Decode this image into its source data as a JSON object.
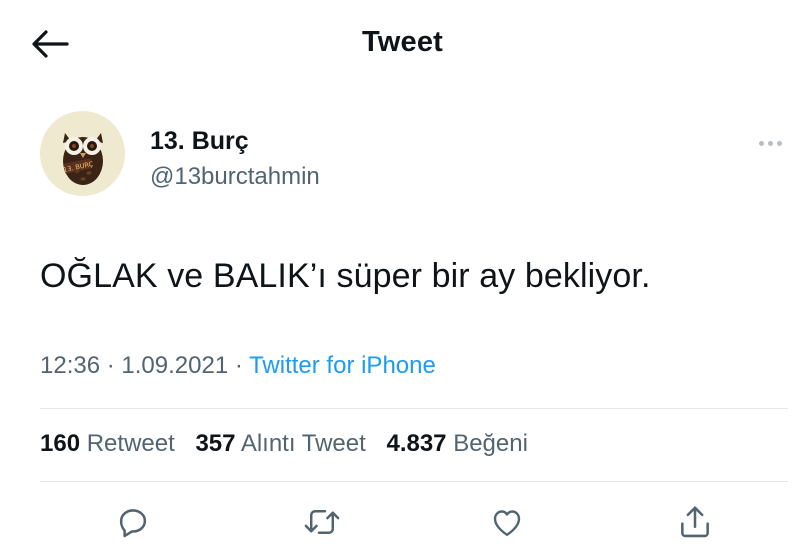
{
  "header": {
    "title": "Tweet",
    "back_icon": "arrow-left-icon"
  },
  "author": {
    "display_name": "13. Burç",
    "handle": "@13burctahmin",
    "avatar_text": "13. BURÇ"
  },
  "more_icon": "more-horizontal-icon",
  "tweet": {
    "text": "OĞLAK ve BALIK’ı süper bir ay bekliyor.",
    "time": "12:36",
    "separator": " · ",
    "date": "1.09.2021",
    "source": "Twitter for iPhone"
  },
  "stats": {
    "retweets_count": "160",
    "retweets_label": "Retweet",
    "quotes_count": "357",
    "quotes_label": "Alıntı Tweet",
    "likes_count": "4.837",
    "likes_label": "Beğeni"
  },
  "actions": [
    "reply-icon",
    "retweet-icon",
    "like-icon",
    "share-icon"
  ],
  "colors": {
    "link": "#1d9bf0",
    "secondary": "#536471",
    "divider": "#e3e7ea",
    "text": "#0f1419"
  }
}
